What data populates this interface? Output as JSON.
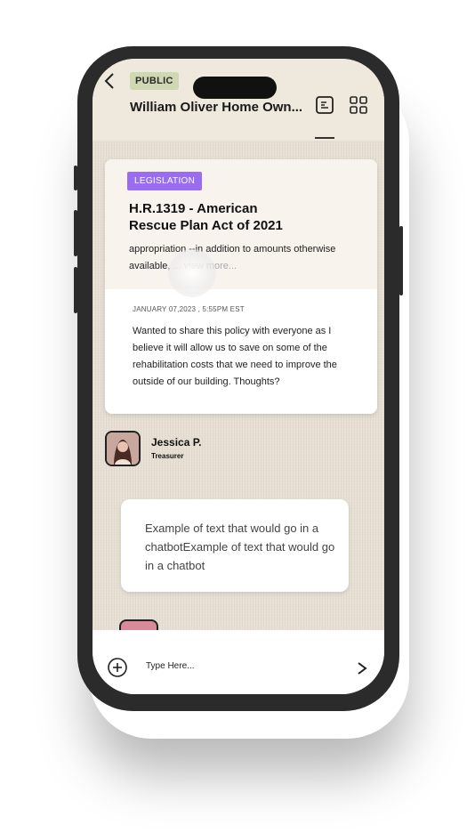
{
  "header": {
    "visibility_badge": "PUBLIC",
    "title": "William Oliver Home Own...",
    "icons": [
      "back-icon",
      "notes-icon",
      "grid-icon"
    ]
  },
  "post": {
    "category_badge": "LEGISLATION",
    "bill_title": "H.R.1319 - American Rescue Plan Act of 2021",
    "bill_excerpt": "appropriation --in addition to amounts otherwise available,",
    "view_more": "... view more...",
    "date": "JANUARY 07,2023 , 5:55PM EST",
    "message": "Wanted to share this policy with everyone  as I believe it will allow us to save on some of the rehabilitation costs that we need to improve the outside of our building. Thoughts?"
  },
  "author": {
    "name": "Jessica P.",
    "role": "Treasurer"
  },
  "reply": {
    "text": "Example of text that would go in a chatbotExample of text that would go in a chatbot"
  },
  "composer": {
    "placeholder": "Type Here...",
    "icons": [
      "plus-icon",
      "send-icon"
    ]
  },
  "colors": {
    "background": "#e7dfd3",
    "public_badge": "#cfd8b3",
    "legislation_badge": "#9a6df0"
  }
}
